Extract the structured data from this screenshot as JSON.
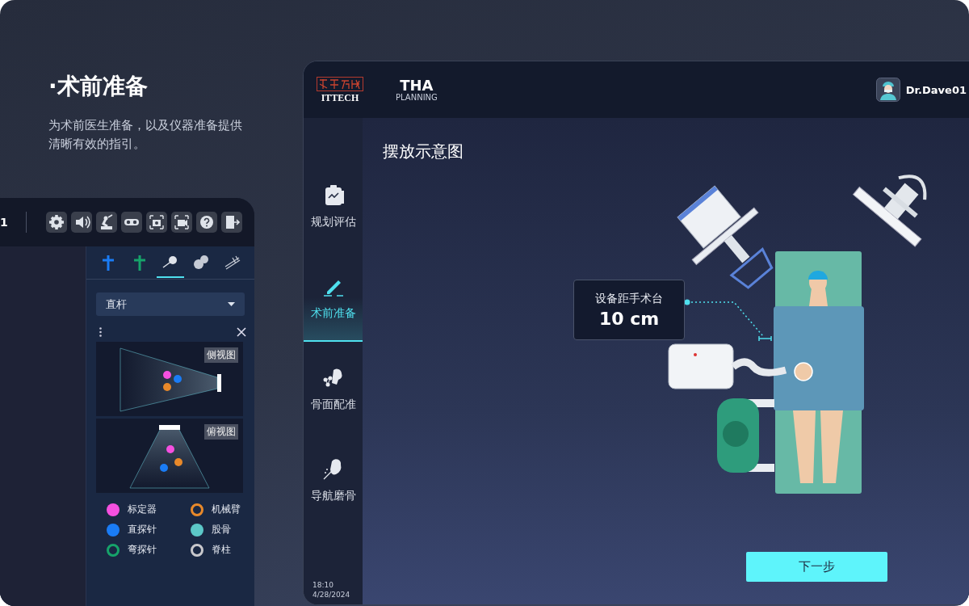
{
  "intro": {
    "title": "·术前准备",
    "description": "为术前医生准备，以及仪器准备提供清晰有效的指引。"
  },
  "left_screen": {
    "header_text": "1",
    "toolbar": [
      {
        "kind": "settings"
      },
      {
        "kind": "volume"
      },
      {
        "kind": "robot"
      },
      {
        "kind": "tracker"
      },
      {
        "kind": "camera"
      },
      {
        "kind": "video"
      },
      {
        "kind": "help"
      },
      {
        "kind": "exit"
      }
    ],
    "tool_tabs": [
      {
        "kind": "blue-cross",
        "selected": false
      },
      {
        "kind": "green-cross",
        "selected": false
      },
      {
        "kind": "probe",
        "selected": true
      },
      {
        "kind": "bone",
        "selected": false
      },
      {
        "kind": "instrument",
        "selected": false
      }
    ],
    "dropdown": {
      "value": "直杆"
    },
    "views": [
      {
        "kind": "side",
        "label": "侧视图"
      },
      {
        "kind": "top",
        "label": "俯视图"
      }
    ],
    "legend": [
      {
        "label": "标定器",
        "kind": "filled",
        "color": "#f550e0"
      },
      {
        "label": "机械臂",
        "kind": "ring",
        "color": "#e8892a"
      },
      {
        "label": "直探针",
        "kind": "filled",
        "color": "#1a7cf5"
      },
      {
        "label": "股骨",
        "kind": "filled",
        "color": "#5cc8c8"
      },
      {
        "label": "弯探针",
        "kind": "ring",
        "color": "#16a36a"
      },
      {
        "label": "脊柱",
        "kind": "ring",
        "color": "#c8c8cc"
      }
    ]
  },
  "right_screen": {
    "header": {
      "logo_text": "ITTECH",
      "app_title": "THA",
      "app_subtitle": "PLANNING",
      "user": "Dr.Dave01"
    },
    "nav": [
      {
        "label": "规划评估",
        "kind": "clipboard",
        "selected": false
      },
      {
        "label": "术前准备",
        "kind": "pen",
        "selected": true
      },
      {
        "label": "骨面配准",
        "kind": "registration",
        "selected": false
      },
      {
        "label": "导航磨骨",
        "kind": "grinding",
        "selected": false
      }
    ],
    "clock": {
      "time": "18:10",
      "date": "4/28/2024"
    },
    "page_title": "摆放示意图",
    "callout": {
      "label": "设备距手术台",
      "value": "10 cm"
    },
    "next_button": "下一步"
  }
}
